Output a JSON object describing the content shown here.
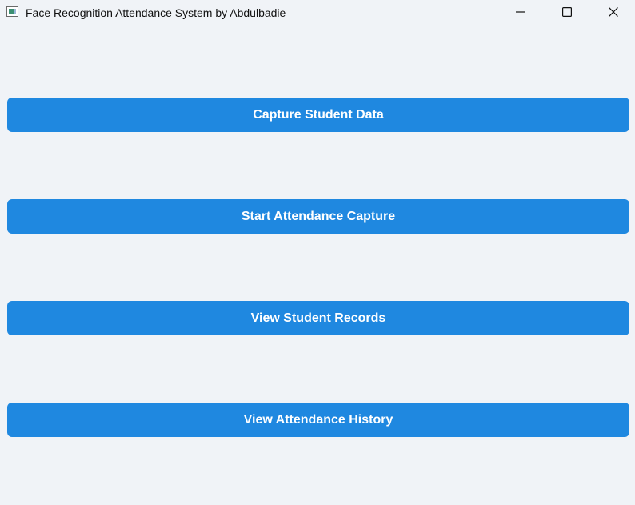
{
  "window": {
    "title": "Face Recognition Attendance System by Abdulbadie",
    "icon": "app-window-icon",
    "controls": [
      "minimize-icon",
      "maximize-icon",
      "close-icon"
    ]
  },
  "buttons": [
    {
      "label": "Capture Student Data"
    },
    {
      "label": "Start Attendance Capture"
    },
    {
      "label": "View Student Records"
    },
    {
      "label": "View Attendance History"
    }
  ],
  "colors": {
    "background": "#f0f3f7",
    "button": "#1f88e0",
    "button_text": "#ffffff"
  }
}
